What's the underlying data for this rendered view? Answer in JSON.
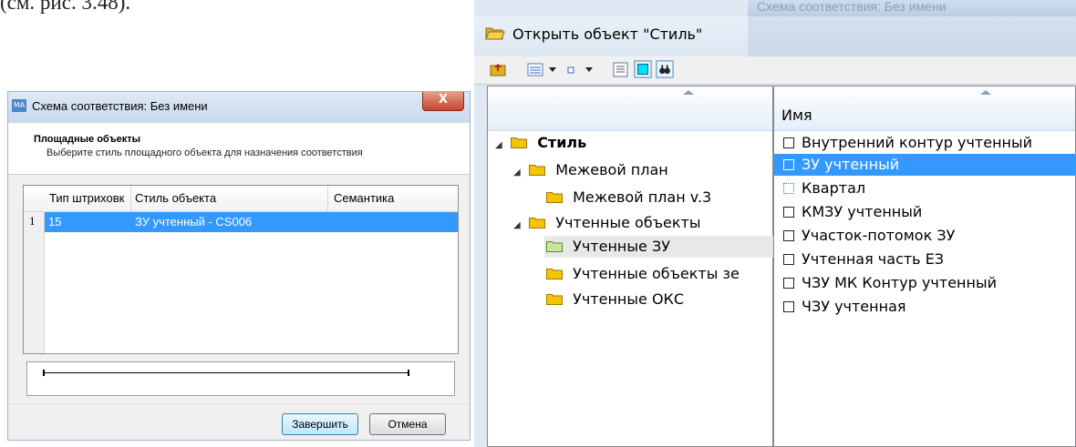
{
  "doc_text": "(см. рис. 3.48).",
  "dialog1": {
    "title": "Схема соответствия: Без имени",
    "close_glyph": "X",
    "header_title": "Площадные объекты",
    "header_subtitle": "Выберите стиль площадного объекта для назначения соответствия",
    "columns": [
      "Тип штриховк",
      "Стиль объекта",
      "Семантика"
    ],
    "rows": [
      {
        "num": "1",
        "type": "15",
        "style": "ЗУ учтенный - CS006",
        "semantic": ""
      }
    ],
    "finish_label": "Завершить",
    "cancel_label": "Отмена"
  },
  "dialog2": {
    "ghost_title": "Схема соответствия: Без имени",
    "title": "Открыть объект \"Стиль\"",
    "list_header": "Имя",
    "tree": [
      {
        "label": "Стиль",
        "expanded": true,
        "bold": true
      },
      {
        "label": "Межевой план",
        "expanded": true
      },
      {
        "label": "Межевой план v.3"
      },
      {
        "label": "Учтенные объекты",
        "expanded": true
      },
      {
        "label": "Учтенные ЗУ",
        "selected": true
      },
      {
        "label": "Учтенные объекты зе"
      },
      {
        "label": "Учтенные ОКС"
      }
    ],
    "items": [
      {
        "label": "Внутренний контур учтенный"
      },
      {
        "label": "ЗУ учтенный",
        "selected": true
      },
      {
        "label": "Квартал",
        "dotted": true
      },
      {
        "label": "КМЗУ учтенный"
      },
      {
        "label": "Участок-потомок ЗУ"
      },
      {
        "label": "Учтенная часть ЕЗ"
      },
      {
        "label": "ЧЗУ МК Контур учтенный"
      },
      {
        "label": "ЧЗУ учтенная"
      }
    ],
    "expand_glyph": "◢"
  },
  "colors": {
    "selection": "#3399ff",
    "folder": "#f5c400",
    "tree_selected_folder": "#c8e6a0",
    "window_frame": "#dfe8f3"
  },
  "icons": [
    "folder-open-icon",
    "folder-up-icon",
    "view-list-icon",
    "dropdown-icon",
    "small-square-icon",
    "details-icon",
    "color-icon",
    "binoculars-icon",
    "folder-icon"
  ]
}
